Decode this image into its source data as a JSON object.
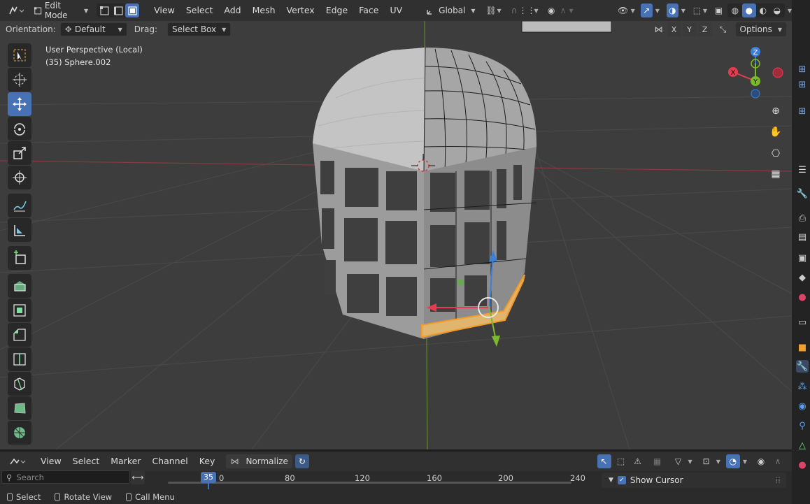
{
  "header": {
    "mode": "Edit Mode",
    "menus": [
      "View",
      "Select",
      "Add",
      "Mesh",
      "Vertex",
      "Edge",
      "Face",
      "UV"
    ],
    "transform_orientation": "Global",
    "icons": [
      "editor-type-icon",
      "vertex-select-icon",
      "edge-select-icon",
      "face-select-icon",
      "pivot-icon",
      "snap-icon",
      "proportional-icon",
      "visibility-icon",
      "gizmo-icon",
      "overlay-icon",
      "xray-icon",
      "wireframe-shading-icon",
      "solid-shading-icon",
      "material-shading-icon",
      "rendered-shading-icon"
    ]
  },
  "tool_settings": {
    "orientation_label": "Orientation:",
    "orientation_value": "Default",
    "drag_label": "Drag:",
    "drag_value": "Select Box",
    "axes": [
      "X",
      "Y",
      "Z"
    ],
    "options_label": "Options"
  },
  "viewport": {
    "view_name": "User Perspective (Local)",
    "object_name": "(35) Sphere.002",
    "gizmo_axes": [
      "X",
      "Y",
      "Z"
    ],
    "colors": {
      "x_axis": "#e63c4f",
      "y_axis": "#7dba2b",
      "z_axis": "#3b7fd6",
      "selection": "#f39a29"
    }
  },
  "toolbar": {
    "tools": [
      "select-box",
      "cursor",
      "move",
      "rotate",
      "scale",
      "transform",
      "annotate",
      "measure",
      "add-cube",
      "extrude",
      "inset",
      "bevel",
      "loop-cut",
      "knife",
      "poly-build",
      "spin"
    ],
    "active": "move"
  },
  "timeline": {
    "menus": [
      "View",
      "Select",
      "Marker",
      "Channel",
      "Key"
    ],
    "normalize_label": "Normalize",
    "search_placeholder": "Search",
    "current_frame": "35",
    "ruler": [
      "0",
      "80",
      "120",
      "160",
      "200",
      "240"
    ],
    "show_cursor_label": "Show Cursor"
  },
  "statusbar": {
    "items": [
      "Select",
      "Rotate View",
      "Call Menu"
    ]
  }
}
